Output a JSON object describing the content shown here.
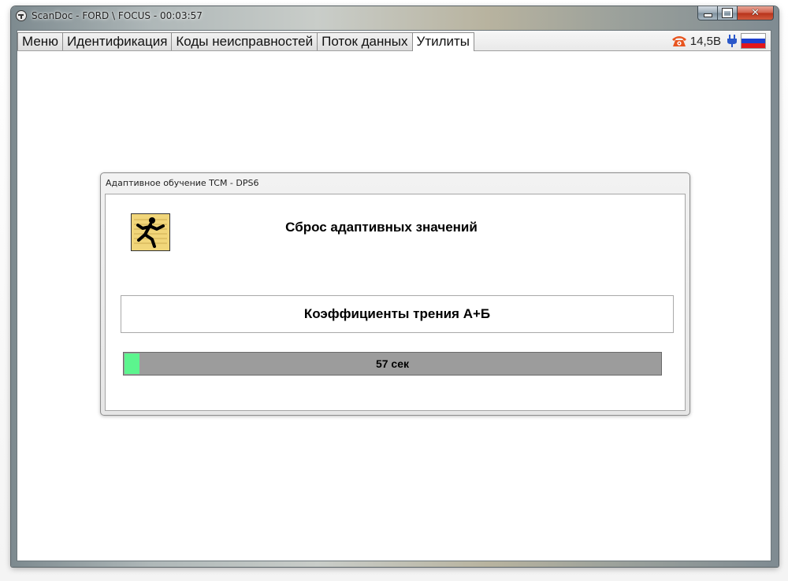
{
  "window": {
    "title": "ScanDoc - FORD \\ FOCUS - 00:03:57",
    "controls": {
      "minimize": "minimize",
      "maximize": "maximize",
      "close": "close"
    }
  },
  "tabs": [
    {
      "label": "Меню",
      "active": false
    },
    {
      "label": "Идентификация",
      "active": false
    },
    {
      "label": "Коды неисправностей",
      "active": false
    },
    {
      "label": "Поток данных",
      "active": false
    },
    {
      "label": "Утилиты",
      "active": true
    }
  ],
  "status": {
    "voltage": "14,5В",
    "icons": [
      "phone-icon",
      "plug-icon",
      "russian-flag-icon"
    ],
    "phone_color": "#e8541e",
    "plug_color": "#2a57c9"
  },
  "dialog": {
    "title": "Адаптивное обучение TCM - DPS6",
    "heading": "Сброс адаптивных значений",
    "step": "Коэффициенты трения А+Б",
    "progress": {
      "text": "57 сек",
      "fraction": 0.03,
      "fill_color": "#5cf58e",
      "track_color": "#9c9c9c"
    }
  }
}
